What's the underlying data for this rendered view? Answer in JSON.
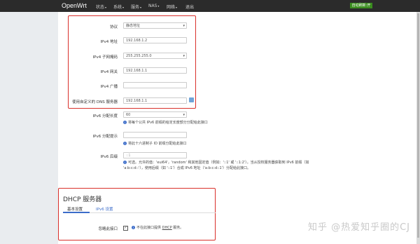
{
  "app": {
    "brand": "OpenWrt",
    "status_badge": "自动刷新:开"
  },
  "nav": [
    {
      "label": "状态",
      "caret": "▾"
    },
    {
      "label": "系统",
      "caret": "▾"
    },
    {
      "label": "服务",
      "caret": "▾"
    },
    {
      "label": "NAS",
      "caret": "▾"
    },
    {
      "label": "网络",
      "caret": "▾"
    },
    {
      "label": "退出",
      "caret": ""
    }
  ],
  "form": {
    "protocol": {
      "label": "协议",
      "value": "静态地址"
    },
    "ipv4_address": {
      "label": "IPv4 地址",
      "value": "192.168.1.2"
    },
    "ipv4_netmask": {
      "label": "IPv4 子网掩码",
      "value": "255.255.255.0"
    },
    "ipv4_gateway": {
      "label": "IPv4 网关",
      "value": "192.168.1.1"
    },
    "ipv4_broadcast": {
      "label": "IPv4 广播",
      "value": ""
    },
    "custom_dns": {
      "label": "使用自定义的 DNS 服务器",
      "value": "192.168.1.1"
    },
    "ipv6_assign_length": {
      "label": "IPv6 分配长度",
      "value": "60",
      "hint": "将每个公共 IPv6 前缀的给定长度部分分配给此接口"
    },
    "ipv6_assign_hint": {
      "label": "IPv6 分配提示",
      "value": "",
      "hint": "将此十六进制子 ID 前缀分配给此接口"
    },
    "ipv6_suffix": {
      "label": "IPv6 后缀",
      "value": "",
      "placeholder": "::1",
      "hint_line1": "可选。允许的值：'eui64'，'random' 和其他固定值（例如：'::1' 或 '::1:2'）。当从授权服务器获取到 IPv6 前缀（如",
      "hint_line2": "'a:b:c:d::'），使用后缀（如 '::1'）合成 IPv6 地址（'a:b:c:d::1'）分配给此接口。"
    }
  },
  "dhcp": {
    "title": "DHCP 服务器",
    "tabs": [
      "基本设置",
      "IPv6 设置"
    ],
    "ignore_interface": {
      "label": "忽略此接口",
      "checked": "✓",
      "hint_pre": "不在此接口提供 ",
      "hint_link": "DHCP",
      "hint_post": " 服务。"
    }
  },
  "watermark": "知乎 @热爱知乎圈的CJ",
  "colors": {
    "accent": "#3b6cc9",
    "highlight_border": "#d9302b",
    "topbar": "#2b2b2b"
  }
}
